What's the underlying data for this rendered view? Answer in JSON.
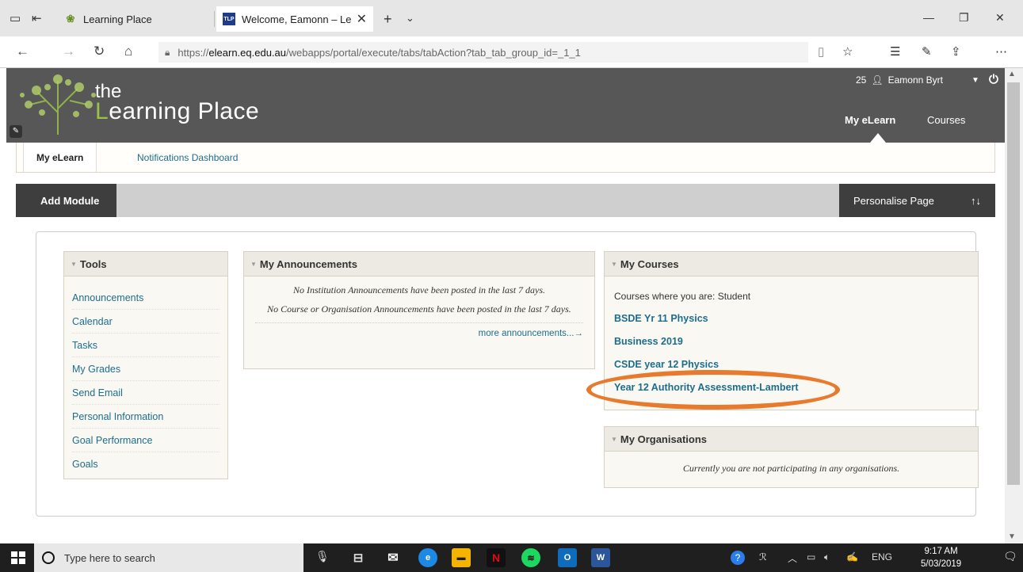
{
  "browser": {
    "tabs": [
      {
        "title": "Learning Place",
        "active": false
      },
      {
        "title": "Welcome, Eamonn – Le",
        "active": true,
        "favicon": "TLP"
      }
    ],
    "url": {
      "prefix": "https://",
      "domain": "elearn.eq.edu.au",
      "path": "/webapps/portal/execute/tabs/tabAction?tab_tab_group_id=_1_1"
    }
  },
  "header": {
    "logo_the": "the",
    "logo_l": "L",
    "logo_rest": "earning Place",
    "notification_count": "25",
    "user_name": "Eamonn Byrt",
    "nav": [
      "My eLearn",
      "Courses"
    ]
  },
  "subnav": {
    "tabs": [
      "My eLearn",
      "Notifications Dashboard"
    ]
  },
  "toolbar": {
    "add_module": "Add Module",
    "personalise": "Personalise Page",
    "sort_icon": "↑↓"
  },
  "modules": {
    "tools": {
      "title": "Tools",
      "items": [
        "Announcements",
        "Calendar",
        "Tasks",
        "My Grades",
        "Send Email",
        "Personal Information",
        "Goal Performance",
        "Goals"
      ]
    },
    "announcements": {
      "title": "My Announcements",
      "messages": [
        "No Institution Announcements have been posted in the last 7 days.",
        "No Course or Organisation Announcements have been posted in the last 7 days."
      ],
      "more": "more announcements...→"
    },
    "courses": {
      "title": "My Courses",
      "label": "Courses where you are: Student",
      "items": [
        "BSDE Yr 11 Physics",
        "Business 2019",
        "CSDE year 12 Physics",
        "Year 12 Authority Assessment-Lambert"
      ]
    },
    "organisations": {
      "title": "My Organisations",
      "message": "Currently you are not participating in any organisations."
    }
  },
  "taskbar": {
    "search_placeholder": "Type here to search",
    "lang": "ENG",
    "time": "9:17 AM",
    "date": "5/03/2019"
  },
  "colors": {
    "link": "#1d6d8e",
    "header_bg": "#575757",
    "highlight": "#e87a2d",
    "accent_green": "#9bc14a"
  }
}
